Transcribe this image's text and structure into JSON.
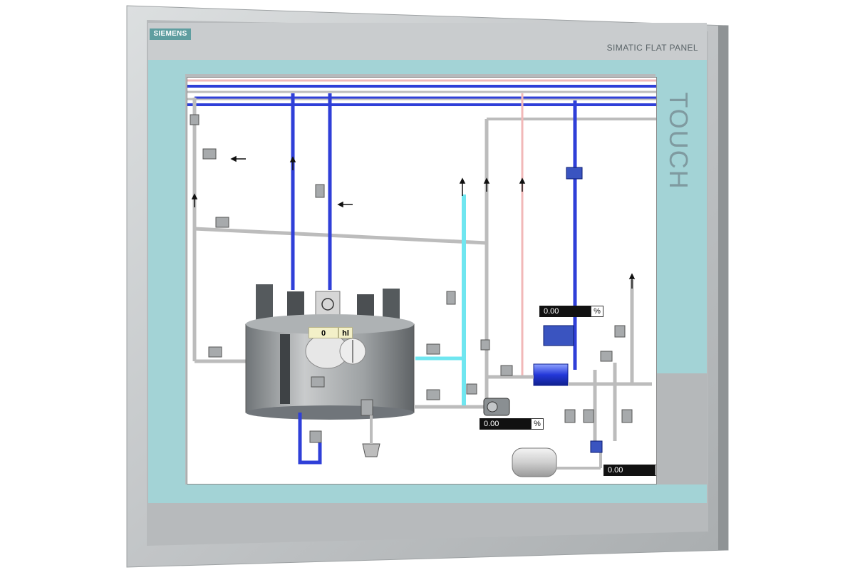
{
  "device": {
    "brand": "SIEMENS",
    "model": "SIMATIC FLAT PANEL",
    "touch_label": "TOUCH"
  },
  "screen": {
    "tank_level": {
      "value": "0",
      "unit": "hl"
    },
    "readouts": [
      {
        "value": "0.00",
        "unit": "%"
      },
      {
        "value": "0.00",
        "unit": "%"
      },
      {
        "value": "0.00",
        "unit": "%"
      }
    ]
  },
  "colors": {
    "bezel": "#c3c6c8",
    "frame_accent": "#a4d5d8",
    "pipe_blue": "#2f3fd8",
    "pipe_gray": "#bcbcbc",
    "pipe_cyan": "#6fe6f0",
    "pipe_pink": "#f2b8b8",
    "tank": "#8a8f92"
  },
  "icons": [
    "valve-icon",
    "pump-icon",
    "heat-exchanger-icon",
    "flow-arrow-icon",
    "agitator-icon",
    "bucket-icon",
    "pressure-vessel-icon"
  ]
}
